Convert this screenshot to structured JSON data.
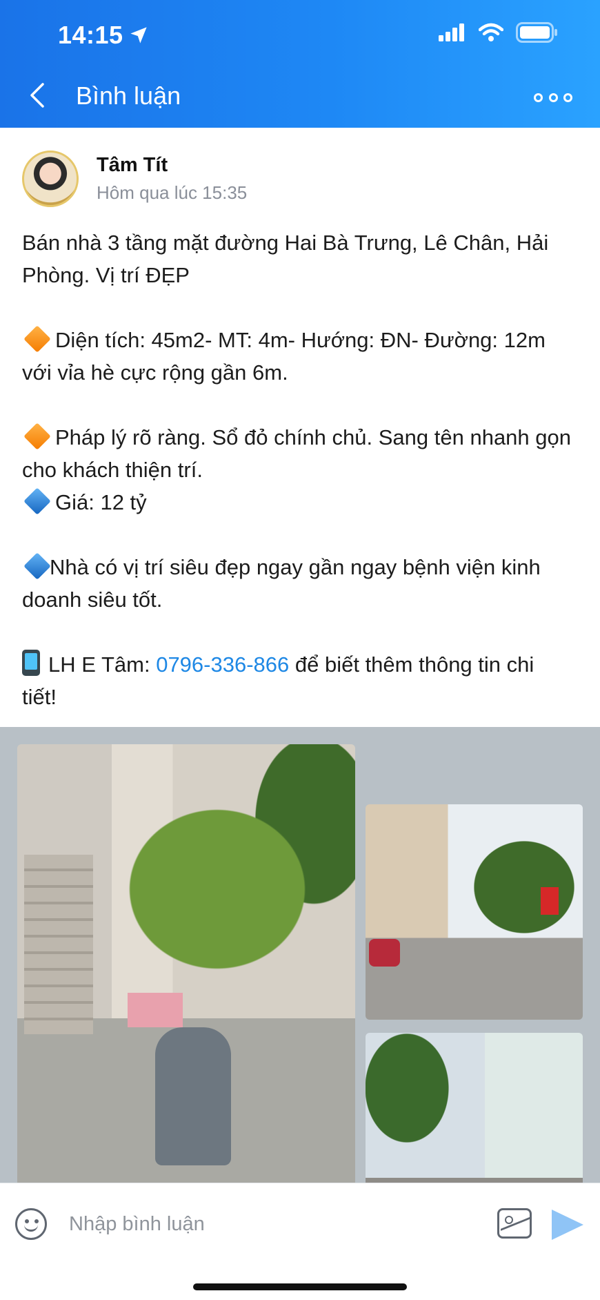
{
  "status_bar": {
    "time": "14:15"
  },
  "header": {
    "title": "Bình luận"
  },
  "post": {
    "author_name": "Tâm Tít",
    "timestamp": "Hôm qua lúc 15:35",
    "line1": "Bán nhà 3 tầng mặt đường Hai Bà Trưng, Lê Chân, Hải Phòng. Vị trí ĐẸP",
    "line2": "Diện tích: 45m2- MT: 4m- Hướng: ĐN- Đường: 12m với vỉa hè cực rộng gần 6m.",
    "line3": "Pháp lý rõ ràng. Sổ đỏ chính chủ. Sang tên nhanh gọn cho khách thiện trí.",
    "line4": "Giá: 12 tỷ",
    "line5": "Nhà có vị trí siêu đẹp ngay gần ngay bệnh viện kinh doanh siêu tốt.",
    "contact_prefix": "LH E Tâm: ",
    "phone": "0796-336-866",
    "contact_suffix": " để biết thêm thông tin chi tiết!"
  },
  "comment_bar": {
    "placeholder": "Nhập bình luận"
  },
  "colors": {
    "header_blue": "#1e88f5",
    "link_blue": "#1e88e5"
  },
  "icons": [
    "location-arrow-icon",
    "signal-icon",
    "wifi-icon",
    "battery-icon",
    "back-chevron-icon",
    "more-icon",
    "orange-diamond-icon",
    "blue-diamond-icon",
    "mobile-phone-icon",
    "emoji-icon",
    "image-icon",
    "send-icon"
  ]
}
